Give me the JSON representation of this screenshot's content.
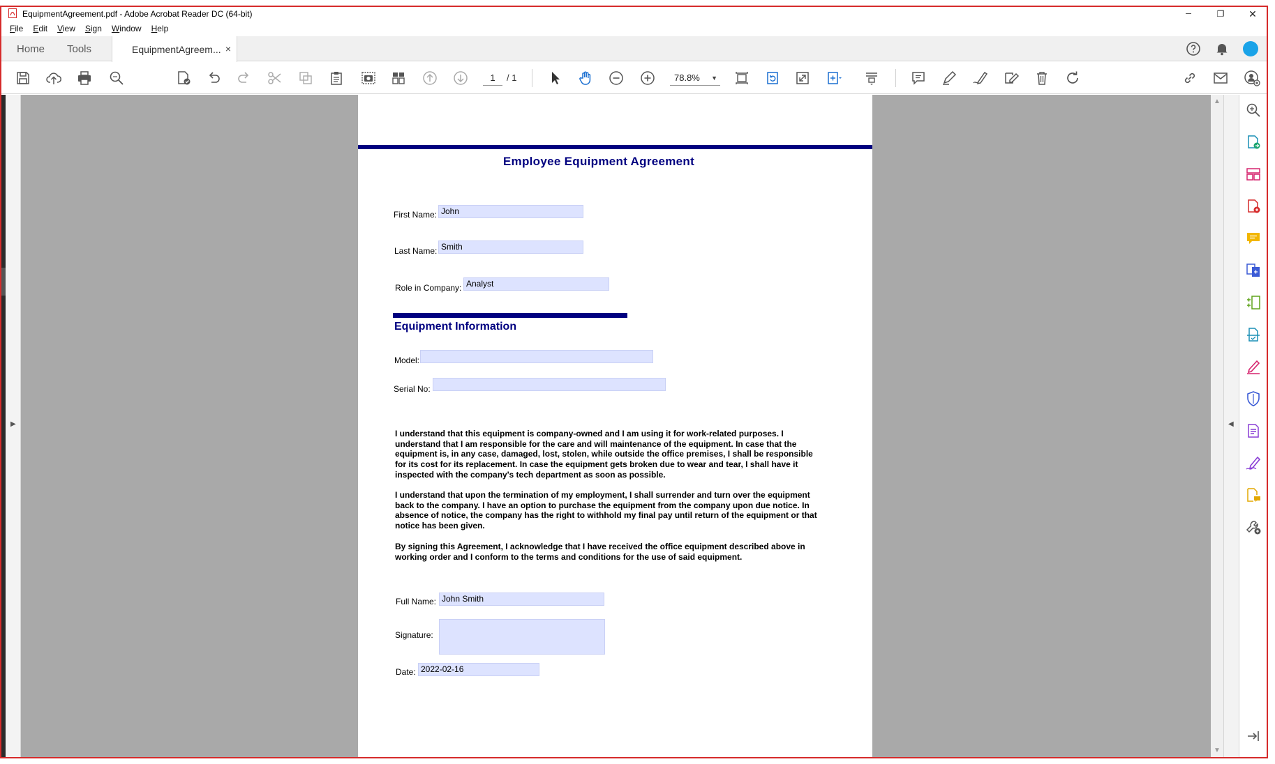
{
  "window": {
    "title": "EquipmentAgreement.pdf - Adobe Acrobat Reader DC (64-bit)",
    "minimize_glyph": "─",
    "restore_glyph": "❐",
    "close_glyph": "✕"
  },
  "menu": {
    "items": [
      {
        "key": "F",
        "rest": "ile"
      },
      {
        "key": "E",
        "rest": "dit"
      },
      {
        "key": "V",
        "rest": "iew"
      },
      {
        "key": "S",
        "rest": "ign"
      },
      {
        "key": "W",
        "rest": "indow"
      },
      {
        "key": "H",
        "rest": "elp"
      }
    ]
  },
  "tabs": {
    "home": "Home",
    "tools": "Tools",
    "document": "EquipmentAgreem...",
    "close_glyph": "×"
  },
  "toolbar": {
    "page_current": "1",
    "page_total": "/ 1",
    "zoom": "78.8%",
    "zoom_arrow": "▼"
  },
  "icons": {
    "left_panel_arrow": "▶",
    "right_panel_arrow": "◀",
    "scroll_up": "▲",
    "scroll_down": "▼"
  },
  "document": {
    "title": "Employee Equipment Agreement",
    "first_name_label": "First Name:",
    "first_name_value": "John",
    "last_name_label": "Last Name:",
    "last_name_value": "Smith",
    "role_label": "Role in Company:",
    "role_value": "Analyst",
    "section_heading": "Equipment Information",
    "model_label": "Model:",
    "model_value": "",
    "serial_label": "Serial No:",
    "serial_value": "",
    "paragraph_1": "I understand that this equipment is company-owned and I am using it for work-related purposes. I understand that I am responsible for the care and will maintenance of the equipment. In case that the equipment is, in any case, damaged, lost, stolen, while outside the office premises, I shall be responsible for its cost for its replacement. In case the equipment gets broken due to wear and tear, I shall have it inspected with the company's tech department as soon as possible.",
    "paragraph_2": "I understand that upon the termination of my employment, I shall surrender and turn over the equipment back to the company. I have an option to purchase the equipment from the company upon due notice. In absence of notice, the company has the right to withhold my final pay until return of the equipment or that notice has been given.",
    "paragraph_3": "By signing this Agreement, I acknowledge that I have received the office equipment described above in working order and I conform to the terms and conditions for the use of said equipment.",
    "full_name_label": "Full Name:",
    "full_name_value": "John Smith",
    "signature_label": "Signature:",
    "signature_value": "",
    "date_label": "Date:",
    "date_value": "2022-02-16"
  },
  "colors": {
    "accent_blue": "#000080",
    "field_fill": "#dde3ff",
    "canvas_gray": "#a9a9a9",
    "frame_red": "#d62b2b",
    "avatar_cyan": "#1aa3e8"
  }
}
